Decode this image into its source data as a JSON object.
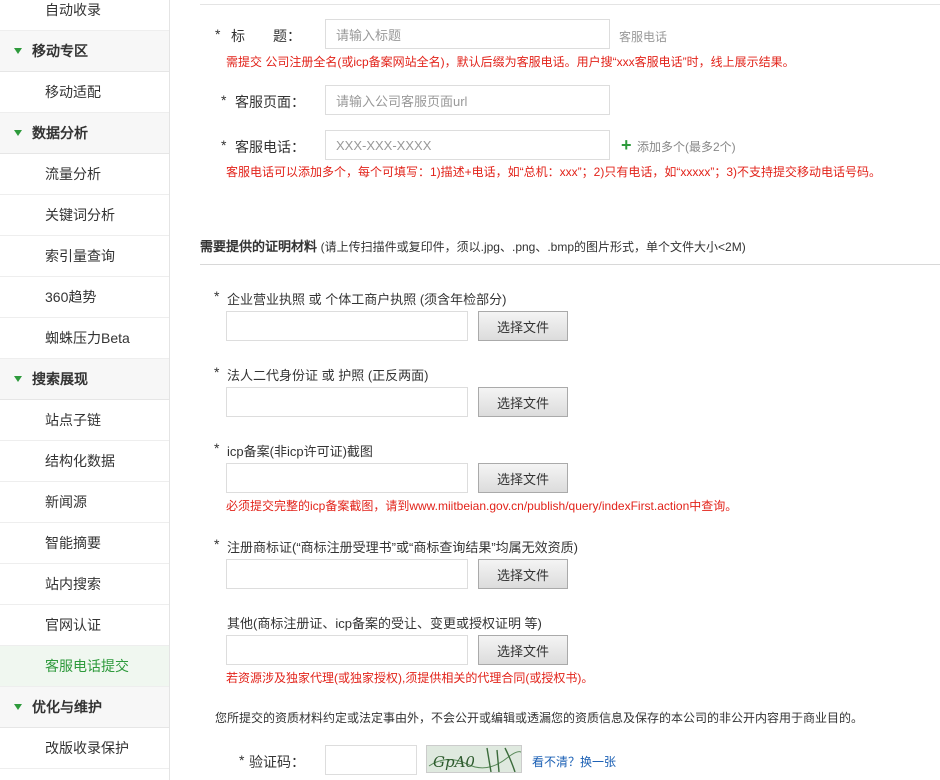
{
  "sidebar": {
    "items": [
      {
        "type": "item",
        "label": "自动收录"
      },
      {
        "type": "group",
        "label": "移动专区"
      },
      {
        "type": "item",
        "label": "移动适配"
      },
      {
        "type": "group",
        "label": "数据分析"
      },
      {
        "type": "item",
        "label": "流量分析"
      },
      {
        "type": "item",
        "label": "关键词分析"
      },
      {
        "type": "item",
        "label": "索引量查询"
      },
      {
        "type": "item",
        "label": "360趋势"
      },
      {
        "type": "item",
        "label": "蜘蛛压力Beta"
      },
      {
        "type": "group",
        "label": "搜索展现"
      },
      {
        "type": "item",
        "label": "站点子链"
      },
      {
        "type": "item",
        "label": "结构化数据"
      },
      {
        "type": "item",
        "label": "新闻源"
      },
      {
        "type": "item",
        "label": "智能摘要"
      },
      {
        "type": "item",
        "label": "站内搜索"
      },
      {
        "type": "item",
        "label": "官网认证"
      },
      {
        "type": "item",
        "label": "客服电话提交",
        "active": true
      },
      {
        "type": "group",
        "label": "优化与维护"
      },
      {
        "type": "item",
        "label": "改版收录保护"
      }
    ]
  },
  "form": {
    "title_label": "标　　题：",
    "title_placeholder": "请输入标题",
    "title_suffix": "客服电话",
    "title_note": "需提交 公司注册全名(或icp备案网站全名)，默认后缀为客服电话。用户搜“xxx客服电话”时，线上展示结果。",
    "page_label": "客服页面：",
    "page_placeholder": "请输入公司客服页面url",
    "phone_label": "客服电话：",
    "phone_placeholder": "XXX-XXX-XXXX",
    "add_more": "添加多个(最多2个)",
    "phone_note": "客服电话可以添加多个，每个可填写：1)描述+电话，如“总机：xxx”；2)只有电话，如“xxxxx”；3)不支持提交移动电话号码。"
  },
  "proof": {
    "heading": "需要提供的证明材料",
    "heading_note": "(请上传扫描件或复印件，须以.jpg、.png、.bmp的图片形式，单个文件大小<2M)",
    "choose_file": "选择文件",
    "docs": [
      {
        "required": true,
        "label": "企业营业执照 或 个体工商户执照 (须含年检部分)",
        "note": ""
      },
      {
        "required": true,
        "label": "法人二代身份证 或 护照 (正反两面)",
        "note": ""
      },
      {
        "required": true,
        "label": "icp备案(非icp许可证)截图",
        "note": "必须提交完整的icp备案截图，请到www.miitbeian.gov.cn/publish/query/indexFirst.action中查询。"
      },
      {
        "required": true,
        "label": "注册商标证(“商标注册受理书”或“商标查询结果”均属无效资质)",
        "note": ""
      },
      {
        "required": false,
        "label": "其他(商标注册证、icp备案的受让、变更或授权证明 等)",
        "note": "若资源涉及独家代理(或独家授权),须提供相关的代理合同(或授权书)。"
      }
    ],
    "privacy": "您所提交的资质材料约定或法定事由外，不会公开或编辑或透漏您的资质信息及保存的本公司的非公开内容用于商业目的。"
  },
  "captcha": {
    "label": "验证码：",
    "image_text": "GpA0",
    "refresh": "看不清？换一张"
  },
  "colors": {
    "accent": "#2e9a3c",
    "error": "#e2231a",
    "link": "#1a5fb4"
  }
}
